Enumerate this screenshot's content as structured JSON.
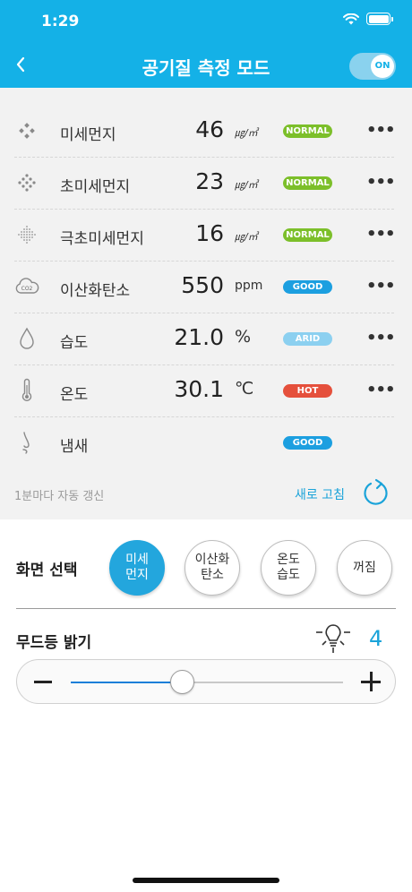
{
  "status_bar": {
    "time": "1:29"
  },
  "header": {
    "title": "공기질 측정 모드",
    "toggle_label": "ON"
  },
  "colors": {
    "accent": "#14b1e7",
    "normal": "#7cbf2a",
    "good": "#1c9fe0",
    "arid": "#8cd0f0",
    "hot": "#e5503c"
  },
  "readings": [
    {
      "icon": "fine-dust-icon",
      "label": "미세먼지",
      "value": "46",
      "unit": "㎍/㎥",
      "status": "NORMAL",
      "status_color": "#7cbf2a",
      "has_more": true
    },
    {
      "icon": "ultrafine-dust-icon",
      "label": "초미세먼지",
      "value": "23",
      "unit": "㎍/㎥",
      "status": "NORMAL",
      "status_color": "#7cbf2a",
      "has_more": true
    },
    {
      "icon": "superfine-dust-icon",
      "label": "극초미세먼지",
      "value": "16",
      "unit": "㎍/㎥",
      "status": "NORMAL",
      "status_color": "#7cbf2a",
      "has_more": true
    },
    {
      "icon": "co2-cloud-icon",
      "label": "이산화탄소",
      "value": "550",
      "unit": "ppm",
      "status": "GOOD",
      "status_color": "#1c9fe0",
      "has_more": true
    },
    {
      "icon": "water-drop-icon",
      "label": "습도",
      "value": "21.0",
      "unit": "%",
      "status": "ARID",
      "status_color": "#8cd0f0",
      "has_more": true
    },
    {
      "icon": "thermometer-icon",
      "label": "온도",
      "value": "30.1",
      "unit": "℃",
      "status": "HOT",
      "status_color": "#e5503c",
      "has_more": true
    },
    {
      "icon": "nose-icon",
      "label": "냄새",
      "value": "",
      "unit": "",
      "status": "GOOD",
      "status_color": "#1c9fe0",
      "has_more": false
    }
  ],
  "refresh": {
    "auto_text": "1분마다 자동 갱신",
    "button_label": "새로 고침"
  },
  "screen_select": {
    "label": "화면 선택",
    "options": [
      {
        "label": "미세\n먼지",
        "active": true
      },
      {
        "label": "이산화\n탄소",
        "active": false
      },
      {
        "label": "온도\n습도",
        "active": false
      },
      {
        "label": "꺼짐",
        "active": false
      }
    ]
  },
  "mood_light": {
    "label": "무드등 밝기",
    "value": "4",
    "level_fraction": 0.41
  }
}
